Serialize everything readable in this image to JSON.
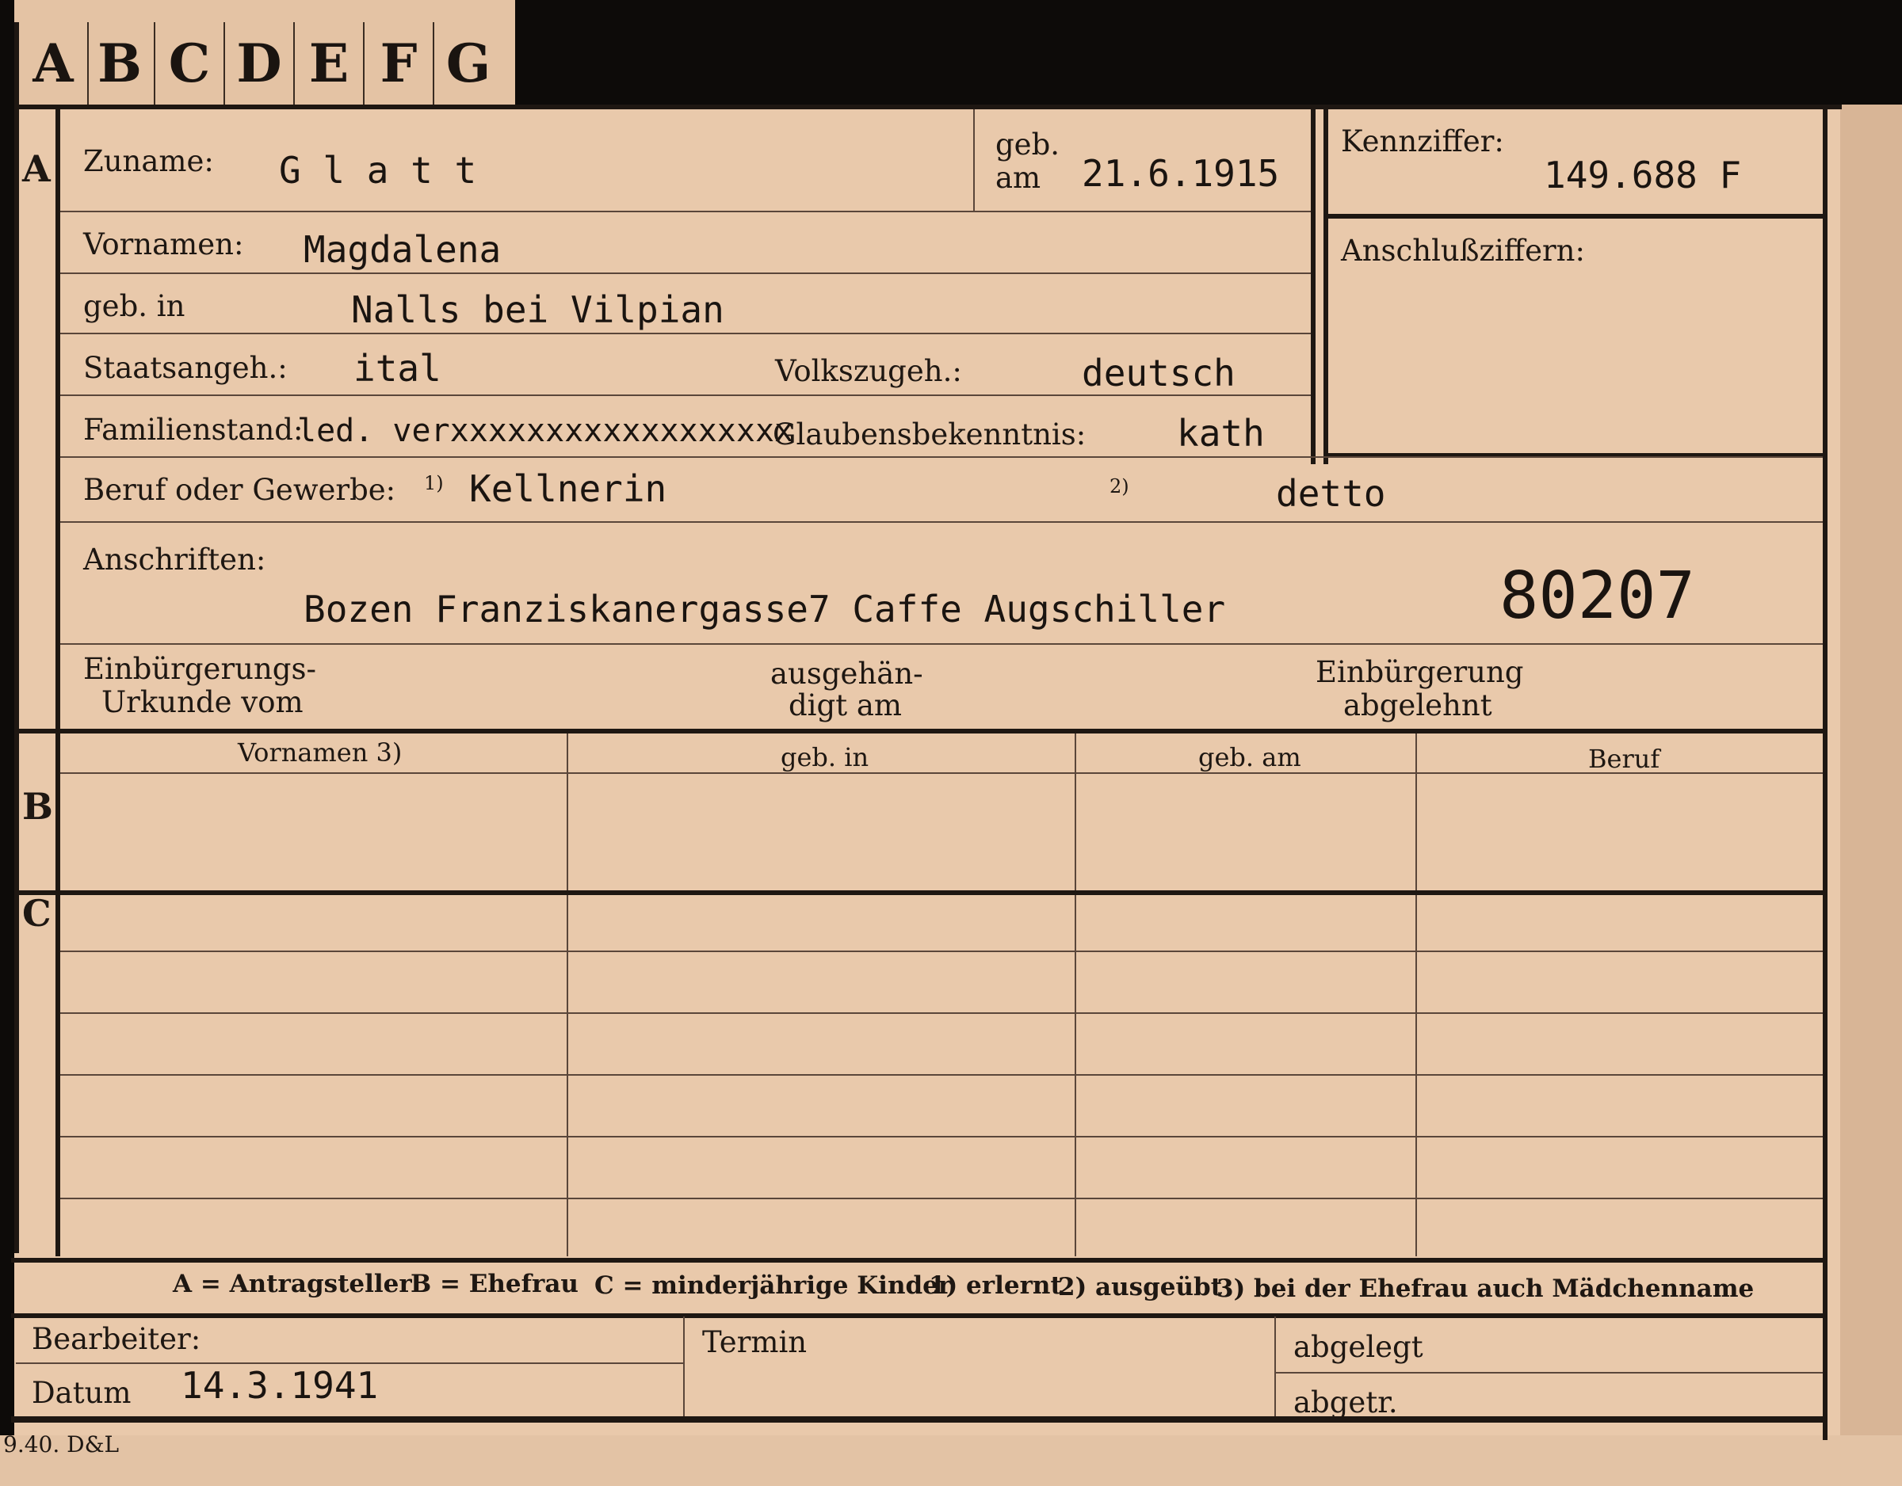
{
  "tabs": [
    "A",
    "B",
    "C",
    "D",
    "E",
    "F",
    "G"
  ],
  "sections": {
    "a": "A",
    "b": "B",
    "c": "C"
  },
  "labels": {
    "zuname": "Zuname:",
    "geb": "geb.",
    "am": "am",
    "kennziffer": "Kennziffer:",
    "vornamen": "Vornamen:",
    "anschlussziffern": "Anschlußziffern:",
    "geb_in": "geb. in",
    "staatsangeh": "Staatsangeh.:",
    "volkszugeh": "Volkszugeh.:",
    "familienstand": "Familienstand:",
    "glaubensbekenntnis": "Glaubensbekenntnis:",
    "beruf": "Beruf oder Gewerbe:",
    "fn1": "1)",
    "fn2": "2)",
    "anschriften": "Anschriften:",
    "einbuergerungsurkunde_1": "Einbürgerungs-",
    "einbuergerungsurkunde_2": "Urkunde vom",
    "ausgehaendigt_1": "ausgehän-",
    "ausgehaendigt_2": "digt am",
    "einbuergerung_abgelehnt_1": "Einbürgerung",
    "einbuergerung_abgelehnt_2": "abgelehnt",
    "bearbeiter": "Bearbeiter:",
    "datum": "Datum",
    "termin": "Termin",
    "abgelegt": "abgelegt",
    "abgetr": "abgetr."
  },
  "values": {
    "zuname": "G l a t t",
    "geb_am": "21.6.1915",
    "kennziffer": "149.688 F",
    "vornamen": "Magdalena",
    "geb_in": "Nalls bei Vilpian",
    "staatsangeh": "ital",
    "volkszugeh": "deutsch",
    "familienstand": "led. verxxxxxxxxxxxxxxxxxx",
    "glaubensbekenntnis": "kath",
    "beruf_1": "Kellnerin",
    "beruf_2": "detto",
    "anschrift": "Bozen Franziskanergasse7 Caffe Augschiller",
    "stamp_number": "80207",
    "datum": "14.3.1941"
  },
  "table_headers": [
    "Vornamen 3)",
    "geb. in",
    "geb. am",
    "Beruf"
  ],
  "footer_legend": {
    "a": "A = Antragsteller",
    "b": "B = Ehefrau",
    "c": "C = minderjährige Kinder",
    "n1": "1) erlernt",
    "n2": "2) ausgeübt",
    "n3": "3) bei der Ehefrau auch Mädchenname"
  },
  "printer_mark": "9.40. D&L",
  "colors": {
    "card": "#e9c9ab",
    "ink": "#1e1712",
    "background": "#0d0b09"
  }
}
